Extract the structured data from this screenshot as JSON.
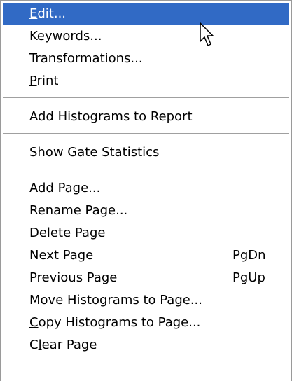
{
  "menu": {
    "groups": [
      {
        "items": [
          {
            "pre": "",
            "mn": "E",
            "post": "dit...",
            "shortcut": ""
          },
          {
            "pre": "Keywords...",
            "mn": "",
            "post": "",
            "shortcut": ""
          },
          {
            "pre": "Transformations...",
            "mn": "",
            "post": "",
            "shortcut": ""
          },
          {
            "pre": "",
            "mn": "P",
            "post": "rint",
            "shortcut": ""
          }
        ]
      },
      {
        "items": [
          {
            "pre": "Add Histograms to Report",
            "mn": "",
            "post": "",
            "shortcut": ""
          }
        ]
      },
      {
        "items": [
          {
            "pre": "Show Gate Statistics",
            "mn": "",
            "post": "",
            "shortcut": ""
          }
        ]
      },
      {
        "items": [
          {
            "pre": "Add Page...",
            "mn": "",
            "post": "",
            "shortcut": ""
          },
          {
            "pre": "Rename Page...",
            "mn": "",
            "post": "",
            "shortcut": ""
          },
          {
            "pre": "Delete Page",
            "mn": "",
            "post": "",
            "shortcut": ""
          },
          {
            "pre": "Next Page",
            "mn": "",
            "post": "",
            "shortcut": "PgDn"
          },
          {
            "pre": "Previous Page",
            "mn": "",
            "post": "",
            "shortcut": "PgUp"
          },
          {
            "pre": "",
            "mn": "M",
            "post": "ove Histograms to Page...",
            "shortcut": ""
          },
          {
            "pre": "",
            "mn": "C",
            "post": "opy Histograms to Page...",
            "shortcut": ""
          },
          {
            "pre": "C",
            "mn": "l",
            "post": "ear Page",
            "shortcut": ""
          }
        ]
      }
    ],
    "highlighted_item": "Edit...",
    "highlight_color": "#316ac5",
    "cursor_icon": "arrow-pointer-icon"
  }
}
